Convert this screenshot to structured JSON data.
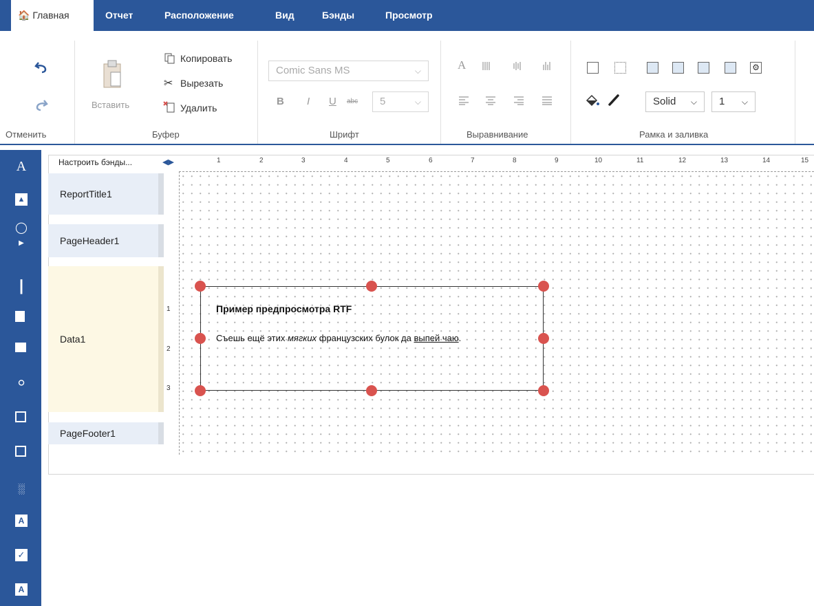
{
  "tabs": {
    "home": "Главная",
    "report": "Отчет",
    "layout": "Расположение",
    "view": "Вид",
    "bands": "Бэнды",
    "preview": "Просмотр"
  },
  "ribbon": {
    "undo_group_label": "Отменить",
    "clipboard": {
      "paste": "Вставить",
      "copy": "Копировать",
      "cut": "Вырезать",
      "delete": "Удалить",
      "group_label": "Буфер"
    },
    "font": {
      "family": "Comic Sans MS",
      "size": "5",
      "bold": "B",
      "italic": "I",
      "underline": "U",
      "strike": "abc",
      "group_label": "Шрифт"
    },
    "align": {
      "group_label": "Выравнивание"
    },
    "border": {
      "style": "Solid",
      "width": "1",
      "group_label": "Рамка и заливка"
    }
  },
  "designer": {
    "configure_bands": "Настроить бэнды...",
    "bands": [
      "ReportTitle1",
      "PageHeader1",
      "Data1",
      "PageFooter1"
    ],
    "ruler_marks": [
      "1",
      "2",
      "3",
      "4",
      "5",
      "6",
      "7",
      "8",
      "9",
      "10",
      "11",
      "12",
      "13",
      "14",
      "15"
    ],
    "vruler_marks": [
      "1",
      "2",
      "3"
    ],
    "rtf_title": "Пример предпросмотра RTF",
    "rtf_body": {
      "part1": "Съешь ещё этих ",
      "italic": "мягких",
      "part2": " французских булок да ",
      "underline": "выпей чаю",
      "part3": "."
    }
  },
  "colors": {
    "accent": "#2b579a",
    "handle": "#d9534f",
    "band_blue": "#e8eef7",
    "band_yellow": "#fdf8e4"
  }
}
